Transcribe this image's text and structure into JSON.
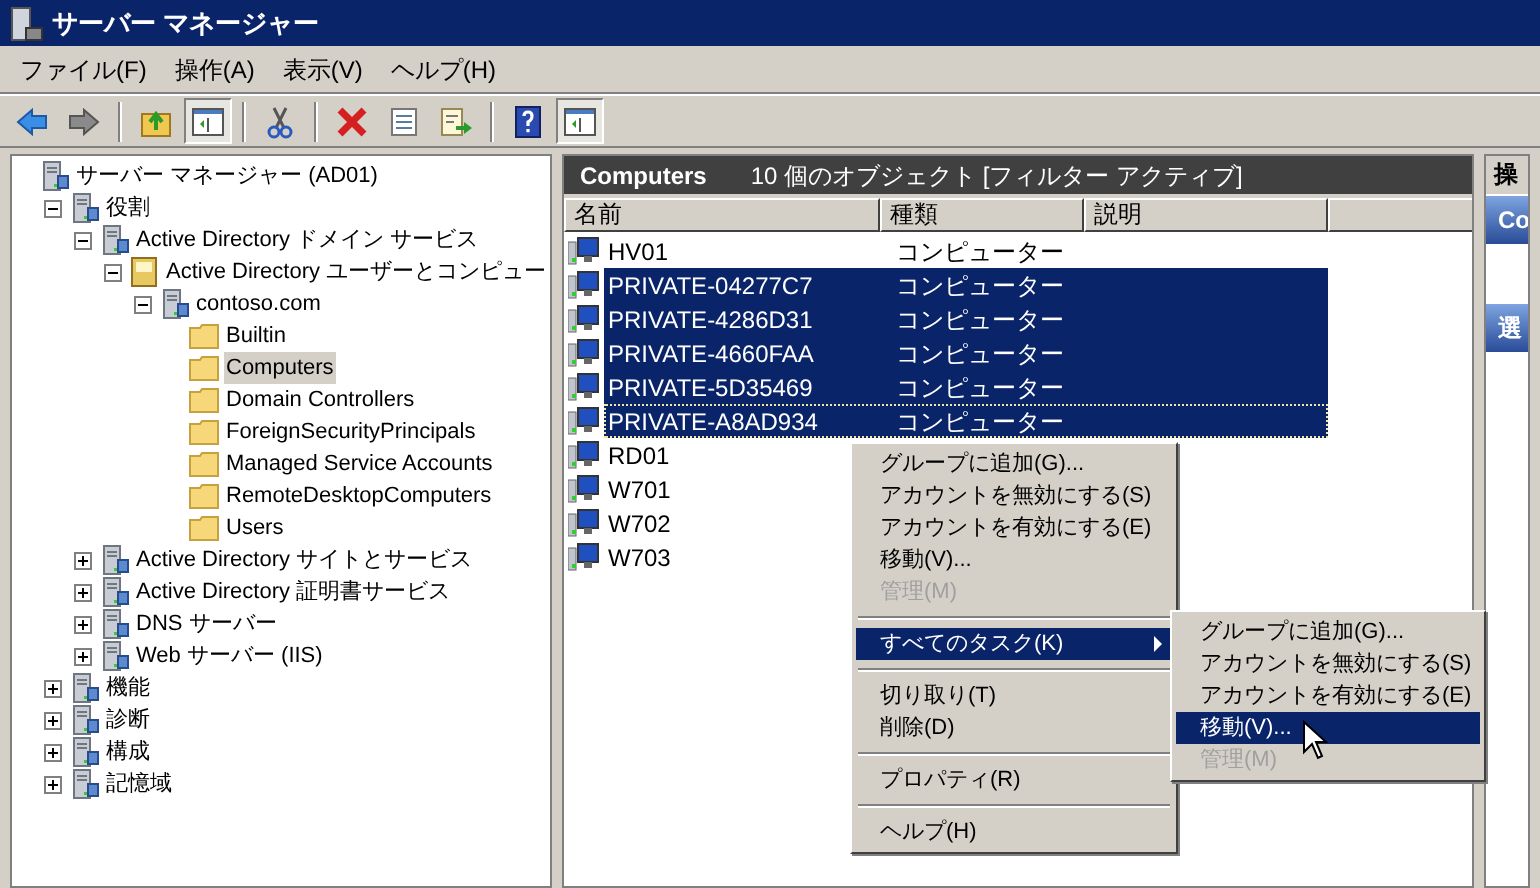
{
  "window": {
    "title": "サーバー マネージャー"
  },
  "menu": [
    "ファイル(F)",
    "操作(A)",
    "表示(V)",
    "ヘルプ(H)"
  ],
  "toolbar": [
    {
      "kind": "button",
      "pressed": false
    },
    {
      "kind": "button",
      "pressed": false
    },
    {
      "kind": "separator"
    },
    {
      "kind": "button",
      "pressed": false
    },
    {
      "kind": "button",
      "pressed": true
    },
    {
      "kind": "separator"
    },
    {
      "kind": "button",
      "pressed": false
    },
    {
      "kind": "separator"
    },
    {
      "kind": "button",
      "pressed": false
    },
    {
      "kind": "button",
      "pressed": false
    },
    {
      "kind": "button",
      "pressed": false
    },
    {
      "kind": "separator"
    },
    {
      "kind": "button",
      "pressed": false
    },
    {
      "kind": "button",
      "pressed": true
    }
  ],
  "tree": [
    {
      "label": "サーバー マネージャー (AD01)",
      "kind": "node",
      "children": [
        {
          "label": "役割",
          "kind": "node",
          "expanded": true,
          "children": [
            {
              "label": "Active Directory ドメイン サービス",
              "kind": "node",
              "expanded": true,
              "children": [
                {
                  "label": "Active Directory ユーザーとコンピュー",
                  "kind": "book",
                  "expanded": true,
                  "children": [
                    {
                      "label": "contoso.com",
                      "kind": "node",
                      "expanded": true,
                      "children": [
                        {
                          "label": "Builtin",
                          "kind": "folder",
                          "selected": false
                        },
                        {
                          "label": "Computers",
                          "kind": "folder",
                          "selected": true
                        },
                        {
                          "label": "Domain Controllers",
                          "kind": "folder",
                          "selected": false
                        },
                        {
                          "label": "ForeignSecurityPrincipals",
                          "kind": "folder",
                          "selected": false
                        },
                        {
                          "label": "Managed Service Accounts",
                          "kind": "folder",
                          "selected": false
                        },
                        {
                          "label": "RemoteDesktopComputers",
                          "kind": "folder",
                          "selected": false
                        },
                        {
                          "label": "Users",
                          "kind": "folder",
                          "selected": false
                        }
                      ]
                    }
                  ]
                }
              ]
            },
            {
              "label": "Active Directory サイトとサービス",
              "kind": "node",
              "expanded": false
            },
            {
              "label": "Active Directory 証明書サービス",
              "kind": "node",
              "expanded": false
            },
            {
              "label": "DNS サーバー",
              "kind": "node",
              "expanded": false
            },
            {
              "label": "Web サーバー (IIS)",
              "kind": "node",
              "expanded": false
            }
          ]
        },
        {
          "label": "機能",
          "kind": "node",
          "expanded": false
        },
        {
          "label": "診断",
          "kind": "node",
          "expanded": false
        },
        {
          "label": "構成",
          "kind": "node",
          "expanded": false
        },
        {
          "label": "記憶域",
          "kind": "node",
          "expanded": false
        }
      ]
    }
  ],
  "list": {
    "title": "Computers",
    "summary": "10 個のオブジェクト [フィルター アクティブ]",
    "columns": [
      "名前",
      "種類",
      "説明"
    ],
    "rows": [
      {
        "name": "HV01",
        "type": "コンピューター",
        "selected": false,
        "focused": false
      },
      {
        "name": "PRIVATE-04277C7",
        "type": "コンピューター",
        "selected": true,
        "focused": false
      },
      {
        "name": "PRIVATE-4286D31",
        "type": "コンピューター",
        "selected": true,
        "focused": false
      },
      {
        "name": "PRIVATE-4660FAA",
        "type": "コンピューター",
        "selected": true,
        "focused": false
      },
      {
        "name": "PRIVATE-5D35469",
        "type": "コンピューター",
        "selected": true,
        "focused": false
      },
      {
        "name": "PRIVATE-A8AD934",
        "type": "コンピューター",
        "selected": true,
        "focused": true
      },
      {
        "name": "RD01",
        "selected": false,
        "focused": false
      },
      {
        "name": "W701",
        "selected": false,
        "focused": false
      },
      {
        "name": "W702",
        "selected": false,
        "focused": false
      },
      {
        "name": "W703",
        "selected": false,
        "focused": false
      }
    ]
  },
  "actions": {
    "header": "操",
    "sections": [
      "Co",
      "選"
    ]
  },
  "context_menu": [
    {
      "kind": "item",
      "label": "グループに追加(G)...",
      "disabled": false,
      "selected": false,
      "submenu": false
    },
    {
      "kind": "item",
      "label": "アカウントを無効にする(S)",
      "disabled": false,
      "selected": false,
      "submenu": false
    },
    {
      "kind": "item",
      "label": "アカウントを有効にする(E)",
      "disabled": false,
      "selected": false,
      "submenu": false
    },
    {
      "kind": "item",
      "label": "移動(V)...",
      "disabled": false,
      "selected": false,
      "submenu": false
    },
    {
      "kind": "item",
      "label": "管理(M)",
      "disabled": true,
      "selected": false,
      "submenu": false
    },
    {
      "kind": "separator"
    },
    {
      "kind": "item",
      "label": "すべてのタスク(K)",
      "disabled": false,
      "selected": true,
      "submenu": true
    },
    {
      "kind": "separator"
    },
    {
      "kind": "item",
      "label": "切り取り(T)",
      "disabled": false,
      "selected": false,
      "submenu": false
    },
    {
      "kind": "item",
      "label": "削除(D)",
      "disabled": false,
      "selected": false,
      "submenu": false
    },
    {
      "kind": "separator"
    },
    {
      "kind": "item",
      "label": "プロパティ(R)",
      "disabled": false,
      "selected": false,
      "submenu": false
    },
    {
      "kind": "separator"
    },
    {
      "kind": "item",
      "label": "ヘルプ(H)",
      "disabled": false,
      "selected": false,
      "submenu": false
    }
  ],
  "submenu": [
    {
      "kind": "item",
      "label": "グループに追加(G)...",
      "disabled": false,
      "selected": false
    },
    {
      "kind": "item",
      "label": "アカウントを無効にする(S)",
      "disabled": false,
      "selected": false
    },
    {
      "kind": "item",
      "label": "アカウントを有効にする(E)",
      "disabled": false,
      "selected": false
    },
    {
      "kind": "item",
      "label": "移動(V)...",
      "disabled": false,
      "selected": true
    },
    {
      "kind": "item",
      "label": "管理(M)",
      "disabled": true,
      "selected": false
    }
  ]
}
